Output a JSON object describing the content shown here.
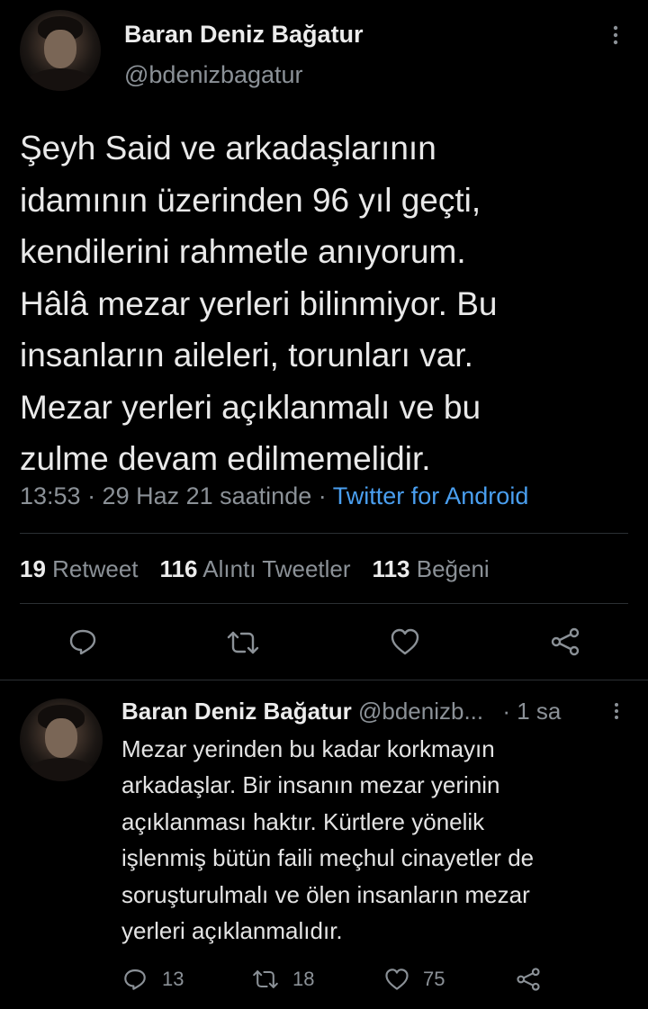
{
  "tweet": {
    "author_name": "Baran Deniz Bağatur",
    "author_handle": "@bdenizbagatur",
    "text_lines": [
      "Şeyh Said ve arkadaşlarının",
      "idamının üzerinden 96 yıl geçti,",
      "kendilerini rahmetle anıyorum.",
      "Hâlâ mezar yerleri bilinmiyor. Bu",
      "insanların aileleri, torunları var.",
      "Mezar yerleri açıklanmalı ve bu",
      "zulme devam edilmemelidir."
    ],
    "timestamp": "13:53 · 29 Haz 21 saatinde · ",
    "source": "Twitter for Android",
    "stats": {
      "retweets_count": "19",
      "retweets_label": " Retweet",
      "quotes_count": "116",
      "quotes_label": " Alıntı Tweetler",
      "likes_count": "113",
      "likes_label": " Beğeni"
    },
    "actions": [
      "reply-icon",
      "retweet-icon",
      "like-icon",
      "share-icon"
    ]
  },
  "reply": {
    "author_name": "Baran Deniz Bağatur",
    "author_handle": "@bdenizb...",
    "time": "· 1 sa",
    "text_lines": [
      "Mezar yerinden bu kadar korkmayın",
      "arkadaşlar. Bir insanın mezar yerinin",
      "açıklanması haktır. Kürtlere yönelik",
      "işlenmiş bütün faili meçhul cinayetler de",
      "soruşturulmalı ve ölen insanların mezar",
      "yerleri açıklanmalıdır."
    ],
    "replies": "13",
    "retweets": "18",
    "likes": "75"
  },
  "colors": {
    "background": "#000000",
    "text": "#d9d9d9",
    "muted": "#8b9197",
    "link": "#4a9ff0",
    "divider": "#2b2f33"
  }
}
